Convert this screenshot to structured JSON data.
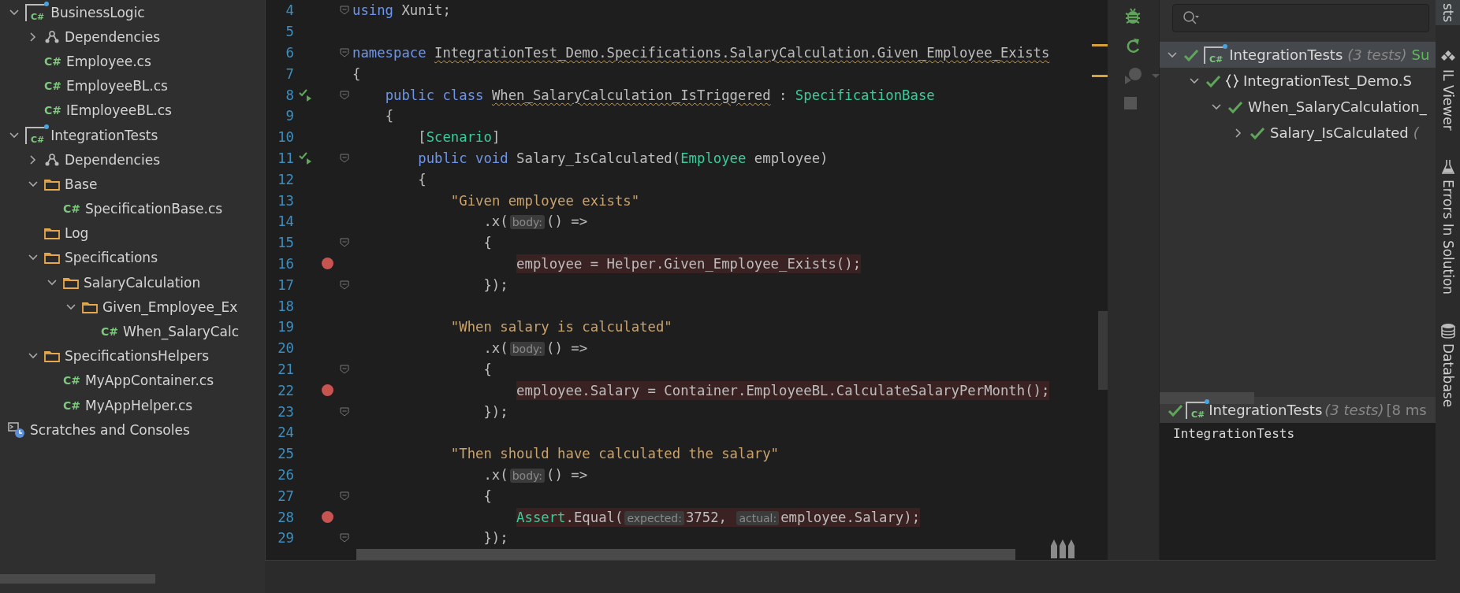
{
  "project_tree": [
    {
      "label": "BusinessLogic",
      "kind": "project",
      "icon_text": "C#",
      "expanded": true,
      "children": [
        {
          "label": "Dependencies",
          "kind": "deps",
          "expanded": false
        },
        {
          "label": "Employee.cs",
          "kind": "cs",
          "icon_text": "C#"
        },
        {
          "label": "EmployeeBL.cs",
          "kind": "cs",
          "icon_text": "C#"
        },
        {
          "label": "IEmployeeBL.cs",
          "kind": "cs",
          "icon_text": "C#"
        }
      ]
    },
    {
      "label": "IntegrationTests",
      "kind": "project",
      "icon_text": "C#",
      "expanded": true,
      "children": [
        {
          "label": "Dependencies",
          "kind": "deps",
          "expanded": false
        },
        {
          "label": "Base",
          "kind": "folder",
          "expanded": true,
          "children": [
            {
              "label": "SpecificationBase.cs",
              "kind": "cs",
              "icon_text": "C#"
            }
          ]
        },
        {
          "label": "Log",
          "kind": "folder"
        },
        {
          "label": "Specifications",
          "kind": "folder",
          "expanded": true,
          "children": [
            {
              "label": "SalaryCalculation",
              "kind": "folder",
              "expanded": true,
              "children": [
                {
                  "label": "Given_Employee_Ex",
                  "kind": "folder",
                  "expanded": true,
                  "children": [
                    {
                      "label": "When_SalaryCalc",
                      "kind": "cs",
                      "icon_text": "C#"
                    }
                  ]
                }
              ]
            }
          ]
        },
        {
          "label": "SpecificationsHelpers",
          "kind": "folder",
          "expanded": true,
          "children": [
            {
              "label": "MyAppContainer.cs",
              "kind": "cs",
              "icon_text": "C#"
            },
            {
              "label": "MyAppHelper.cs",
              "kind": "cs",
              "icon_text": "C#"
            }
          ]
        }
      ]
    },
    {
      "label": "Scratches and Consoles",
      "kind": "scratches"
    }
  ],
  "editor": {
    "lines": [
      {
        "number": "4",
        "fold": true,
        "tokens": [
          {
            "kind": "keyword",
            "text": "using"
          },
          {
            "kind": "plain",
            "text": " Xunit;"
          }
        ]
      },
      {
        "number": "5"
      },
      {
        "number": "6",
        "fold": true,
        "tokens": [
          {
            "kind": "keyword",
            "text": "namespace "
          },
          {
            "kind": "warning",
            "text": "IntegrationTest_Demo.Specifications.SalaryCalculation.Given_Employee_Exists"
          }
        ]
      },
      {
        "number": "7",
        "tokens": [
          {
            "kind": "plain",
            "text": "{"
          }
        ]
      },
      {
        "number": "8",
        "fold": true,
        "run_marker": true,
        "tokens": [
          {
            "kind": "keyword",
            "text": "    public class "
          },
          {
            "kind": "warning",
            "text": "When_SalaryCalculation_IsTriggered"
          },
          {
            "kind": "plain",
            "text": " : "
          },
          {
            "kind": "type",
            "text": "SpecificationBase"
          }
        ]
      },
      {
        "number": "9",
        "tokens": [
          {
            "kind": "plain",
            "text": "    {"
          }
        ]
      },
      {
        "number": "10",
        "tokens": [
          {
            "kind": "plain",
            "text": "        ["
          },
          {
            "kind": "type",
            "text": "Scenario"
          },
          {
            "kind": "plain",
            "text": "]"
          }
        ]
      },
      {
        "number": "11",
        "fold": true,
        "run_marker": true,
        "tokens": [
          {
            "kind": "keyword",
            "text": "        public void"
          },
          {
            "kind": "plain",
            "text": " Salary_IsCalculated("
          },
          {
            "kind": "type",
            "text": "Employee"
          },
          {
            "kind": "plain",
            "text": " employee)"
          }
        ]
      },
      {
        "number": "12",
        "tokens": [
          {
            "kind": "plain",
            "text": "        {"
          }
        ]
      },
      {
        "number": "13",
        "tokens": [
          {
            "kind": "string",
            "text": "            \"Given employee exists\""
          }
        ]
      },
      {
        "number": "14",
        "tokens": [
          {
            "kind": "plain",
            "text": "                .x("
          },
          {
            "kind": "hint",
            "text": "body:"
          },
          {
            "kind": "plain",
            "text": "() =>"
          }
        ]
      },
      {
        "number": "15",
        "fold": true,
        "tokens": [
          {
            "kind": "plain",
            "text": "                {"
          }
        ]
      },
      {
        "number": "16",
        "breakpoint": true,
        "tokens": [
          {
            "kind": "plain",
            "text": "                    employee = Helper.Given_Employee_Exists();"
          }
        ]
      },
      {
        "number": "17",
        "fold": true,
        "tokens": [
          {
            "kind": "plain",
            "text": "                });"
          }
        ]
      },
      {
        "number": "18"
      },
      {
        "number": "19",
        "tokens": [
          {
            "kind": "string",
            "text": "            \"When salary is calculated\""
          }
        ]
      },
      {
        "number": "20",
        "tokens": [
          {
            "kind": "plain",
            "text": "                .x("
          },
          {
            "kind": "hint",
            "text": "body:"
          },
          {
            "kind": "plain",
            "text": "() =>"
          }
        ]
      },
      {
        "number": "21",
        "fold": true,
        "tokens": [
          {
            "kind": "plain",
            "text": "                {"
          }
        ]
      },
      {
        "number": "22",
        "breakpoint": true,
        "tokens": [
          {
            "kind": "plain",
            "text": "                    employee.Salary = Container.EmployeeBL.CalculateSalaryPerMonth();"
          }
        ]
      },
      {
        "number": "23",
        "fold": true,
        "tokens": [
          {
            "kind": "plain",
            "text": "                });"
          }
        ]
      },
      {
        "number": "24"
      },
      {
        "number": "25",
        "tokens": [
          {
            "kind": "string",
            "text": "            \"Then should have calculated the salary\""
          }
        ]
      },
      {
        "number": "26",
        "tokens": [
          {
            "kind": "plain",
            "text": "                .x("
          },
          {
            "kind": "hint",
            "text": "body:"
          },
          {
            "kind": "plain",
            "text": "() =>"
          }
        ]
      },
      {
        "number": "27",
        "fold": true,
        "tokens": [
          {
            "kind": "plain",
            "text": "                {"
          }
        ]
      },
      {
        "number": "28",
        "breakpoint": true,
        "tokens": [
          {
            "kind": "type",
            "text": "                    Assert"
          },
          {
            "kind": "plain",
            "text": ".Equal("
          },
          {
            "kind": "hint",
            "text": "expected:"
          },
          {
            "kind": "plain",
            "text": "3752, "
          },
          {
            "kind": "hint",
            "text": "actual:"
          },
          {
            "kind": "plain",
            "text": "employee.Salary);"
          }
        ]
      },
      {
        "number": "29",
        "fold": true,
        "tokens": [
          {
            "kind": "plain",
            "text": "                });"
          }
        ]
      }
    ]
  },
  "test_tree": [
    {
      "label": "IntegrationTests",
      "kind": "project",
      "icon_text": "C#",
      "passed": true,
      "extra": "(3 tests)",
      "status": "Su",
      "expanded": true,
      "selected": true,
      "children": [
        {
          "label": "IntegrationTest_Demo.S",
          "kind": "namespace",
          "passed": true,
          "expanded": true,
          "selected": false,
          "children": [
            {
              "label": "When_SalaryCalculation_",
              "passed": true,
              "expanded": true,
              "selected": false,
              "children": [
                {
                  "label": "Salary_IsCalculated",
                  "passed": true,
                  "extra": "(",
                  "expanded": false,
                  "selected": false
                }
              ]
            }
          ]
        }
      ]
    }
  ],
  "test_status": {
    "label": "IntegrationTests",
    "icon_text": "C#",
    "passed": true,
    "extra": "(3 tests)",
    "duration": "[8 ms"
  },
  "test_output": "IntegrationTests",
  "side_tabs": [
    {
      "label": "sts",
      "selected": true
    },
    {
      "label": "IL Viewer",
      "selected": false
    },
    {
      "label": "Errors In Solution",
      "selected": false
    },
    {
      "label": "Database",
      "selected": false
    }
  ]
}
